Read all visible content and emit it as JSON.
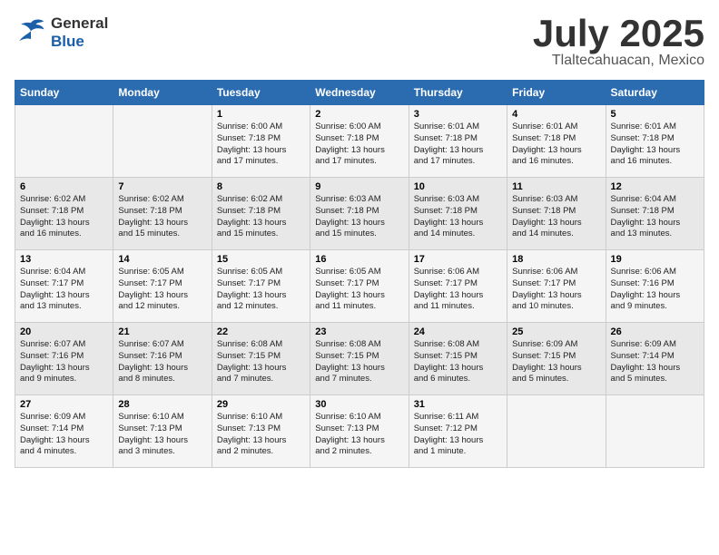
{
  "header": {
    "logo_line1": "General",
    "logo_line2": "Blue",
    "month": "July 2025",
    "location": "Tlaltecahuacan, Mexico"
  },
  "weekdays": [
    "Sunday",
    "Monday",
    "Tuesday",
    "Wednesday",
    "Thursday",
    "Friday",
    "Saturday"
  ],
  "weeks": [
    [
      {
        "day": "",
        "info": ""
      },
      {
        "day": "",
        "info": ""
      },
      {
        "day": "1",
        "info": "Sunrise: 6:00 AM\nSunset: 7:18 PM\nDaylight: 13 hours\nand 17 minutes."
      },
      {
        "day": "2",
        "info": "Sunrise: 6:00 AM\nSunset: 7:18 PM\nDaylight: 13 hours\nand 17 minutes."
      },
      {
        "day": "3",
        "info": "Sunrise: 6:01 AM\nSunset: 7:18 PM\nDaylight: 13 hours\nand 17 minutes."
      },
      {
        "day": "4",
        "info": "Sunrise: 6:01 AM\nSunset: 7:18 PM\nDaylight: 13 hours\nand 16 minutes."
      },
      {
        "day": "5",
        "info": "Sunrise: 6:01 AM\nSunset: 7:18 PM\nDaylight: 13 hours\nand 16 minutes."
      }
    ],
    [
      {
        "day": "6",
        "info": "Sunrise: 6:02 AM\nSunset: 7:18 PM\nDaylight: 13 hours\nand 16 minutes."
      },
      {
        "day": "7",
        "info": "Sunrise: 6:02 AM\nSunset: 7:18 PM\nDaylight: 13 hours\nand 15 minutes."
      },
      {
        "day": "8",
        "info": "Sunrise: 6:02 AM\nSunset: 7:18 PM\nDaylight: 13 hours\nand 15 minutes."
      },
      {
        "day": "9",
        "info": "Sunrise: 6:03 AM\nSunset: 7:18 PM\nDaylight: 13 hours\nand 15 minutes."
      },
      {
        "day": "10",
        "info": "Sunrise: 6:03 AM\nSunset: 7:18 PM\nDaylight: 13 hours\nand 14 minutes."
      },
      {
        "day": "11",
        "info": "Sunrise: 6:03 AM\nSunset: 7:18 PM\nDaylight: 13 hours\nand 14 minutes."
      },
      {
        "day": "12",
        "info": "Sunrise: 6:04 AM\nSunset: 7:18 PM\nDaylight: 13 hours\nand 13 minutes."
      }
    ],
    [
      {
        "day": "13",
        "info": "Sunrise: 6:04 AM\nSunset: 7:17 PM\nDaylight: 13 hours\nand 13 minutes."
      },
      {
        "day": "14",
        "info": "Sunrise: 6:05 AM\nSunset: 7:17 PM\nDaylight: 13 hours\nand 12 minutes."
      },
      {
        "day": "15",
        "info": "Sunrise: 6:05 AM\nSunset: 7:17 PM\nDaylight: 13 hours\nand 12 minutes."
      },
      {
        "day": "16",
        "info": "Sunrise: 6:05 AM\nSunset: 7:17 PM\nDaylight: 13 hours\nand 11 minutes."
      },
      {
        "day": "17",
        "info": "Sunrise: 6:06 AM\nSunset: 7:17 PM\nDaylight: 13 hours\nand 11 minutes."
      },
      {
        "day": "18",
        "info": "Sunrise: 6:06 AM\nSunset: 7:17 PM\nDaylight: 13 hours\nand 10 minutes."
      },
      {
        "day": "19",
        "info": "Sunrise: 6:06 AM\nSunset: 7:16 PM\nDaylight: 13 hours\nand 9 minutes."
      }
    ],
    [
      {
        "day": "20",
        "info": "Sunrise: 6:07 AM\nSunset: 7:16 PM\nDaylight: 13 hours\nand 9 minutes."
      },
      {
        "day": "21",
        "info": "Sunrise: 6:07 AM\nSunset: 7:16 PM\nDaylight: 13 hours\nand 8 minutes."
      },
      {
        "day": "22",
        "info": "Sunrise: 6:08 AM\nSunset: 7:15 PM\nDaylight: 13 hours\nand 7 minutes."
      },
      {
        "day": "23",
        "info": "Sunrise: 6:08 AM\nSunset: 7:15 PM\nDaylight: 13 hours\nand 7 minutes."
      },
      {
        "day": "24",
        "info": "Sunrise: 6:08 AM\nSunset: 7:15 PM\nDaylight: 13 hours\nand 6 minutes."
      },
      {
        "day": "25",
        "info": "Sunrise: 6:09 AM\nSunset: 7:15 PM\nDaylight: 13 hours\nand 5 minutes."
      },
      {
        "day": "26",
        "info": "Sunrise: 6:09 AM\nSunset: 7:14 PM\nDaylight: 13 hours\nand 5 minutes."
      }
    ],
    [
      {
        "day": "27",
        "info": "Sunrise: 6:09 AM\nSunset: 7:14 PM\nDaylight: 13 hours\nand 4 minutes."
      },
      {
        "day": "28",
        "info": "Sunrise: 6:10 AM\nSunset: 7:13 PM\nDaylight: 13 hours\nand 3 minutes."
      },
      {
        "day": "29",
        "info": "Sunrise: 6:10 AM\nSunset: 7:13 PM\nDaylight: 13 hours\nand 2 minutes."
      },
      {
        "day": "30",
        "info": "Sunrise: 6:10 AM\nSunset: 7:13 PM\nDaylight: 13 hours\nand 2 minutes."
      },
      {
        "day": "31",
        "info": "Sunrise: 6:11 AM\nSunset: 7:12 PM\nDaylight: 13 hours\nand 1 minute."
      },
      {
        "day": "",
        "info": ""
      },
      {
        "day": "",
        "info": ""
      }
    ]
  ]
}
